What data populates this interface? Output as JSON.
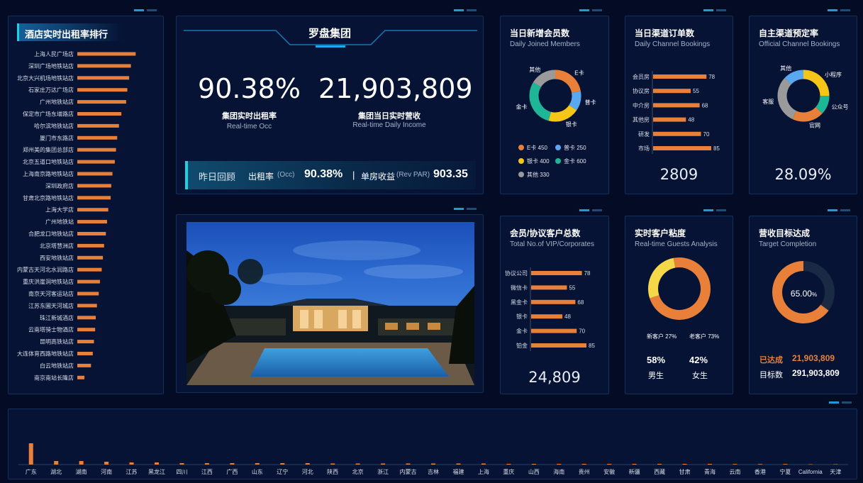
{
  "ranking": {
    "title": "酒店实时出租率排行",
    "items": [
      {
        "name": "上海人民广场店",
        "value": 0.98
      },
      {
        "name": "深圳广场地铁站店",
        "value": 0.9
      },
      {
        "name": "北京大兴机场地铁站店",
        "value": 0.87
      },
      {
        "name": "石家庄万达广场店",
        "value": 0.84
      },
      {
        "name": "广州地铁站店",
        "value": 0.82
      },
      {
        "name": "保定市广场东增路店",
        "value": 0.74
      },
      {
        "name": "哈尔滨地铁站店",
        "value": 0.7
      },
      {
        "name": "厦门市东路店",
        "value": 0.67
      },
      {
        "name": "郑州美的集团总部店",
        "value": 0.65
      },
      {
        "name": "北京五道口地铁站店",
        "value": 0.63
      },
      {
        "name": "上海南京路地铁站店",
        "value": 0.59
      },
      {
        "name": "深圳政府店",
        "value": 0.57
      },
      {
        "name": "甘肃北京路地铁站店",
        "value": 0.56
      },
      {
        "name": "上海大学店",
        "value": 0.52
      },
      {
        "name": "广州地铁站",
        "value": 0.5
      },
      {
        "name": "合肥龙口地铁站店",
        "value": 0.48
      },
      {
        "name": "北京塔慧洲店",
        "value": 0.45
      },
      {
        "name": "西安地铁站店",
        "value": 0.43
      },
      {
        "name": "内蒙古天河北水润路店",
        "value": 0.41
      },
      {
        "name": "重庆洪崖洞地铁站店",
        "value": 0.38
      },
      {
        "name": "南京天河客运站店",
        "value": 0.36
      },
      {
        "name": "江苏东圃天河城店",
        "value": 0.33
      },
      {
        "name": "珠江新城酒店",
        "value": 0.31
      },
      {
        "name": "云南塔骑士物酒店",
        "value": 0.3
      },
      {
        "name": "昆明高铁站店",
        "value": 0.28
      },
      {
        "name": "大连体育西路地铁站店",
        "value": 0.26
      },
      {
        "name": "白云地铁站店",
        "value": 0.23
      },
      {
        "name": "南京南站长隆店",
        "value": 0.12
      }
    ]
  },
  "group": {
    "name": "罗盘集团",
    "occ_value": "90.38%",
    "occ_label": "集团实时出租率",
    "occ_sub": "Real-time Occ",
    "income_value": "21,903,809",
    "income_label": "集团当日实时营收",
    "income_sub": "Real-time Daily Income",
    "review_label": "昨日回顾",
    "review_occ_label": "出租率",
    "review_occ_sub": "(Occ)",
    "review_occ_value": "90.38%",
    "review_sep": "|",
    "review_revpar_label": "单房收益",
    "review_revpar_sub": "(Rev PAR)",
    "review_revpar_value": "903.35"
  },
  "members": {
    "title": "当日新增会员数",
    "sub": "Daily Joined Members",
    "slices": [
      {
        "name": "E卡",
        "value": 450,
        "color": "#e8803a",
        "legend": "E卡 450"
      },
      {
        "name": "普卡",
        "value": 250,
        "color": "#5aa9f0",
        "legend": "普卡 250"
      },
      {
        "name": "银卡",
        "value": 400,
        "color": "#f5c518",
        "legend": "银卡 400"
      },
      {
        "name": "金卡",
        "value": 600,
        "color": "#1fb597",
        "legend": "金卡 600"
      },
      {
        "name": "其他",
        "value": 330,
        "color": "#9a9a9a",
        "legend": "其他 330"
      }
    ]
  },
  "channel": {
    "title": "当日渠道订单数",
    "sub": "Daily Channel Bookings",
    "total": "2809",
    "chart_data": {
      "type": "bar",
      "categories": [
        "会员房",
        "协议房",
        "中介房",
        "其他房",
        "研发",
        "市场"
      ],
      "values": [
        78,
        55,
        68,
        48,
        70,
        85
      ]
    }
  },
  "official": {
    "title": "自主渠道预定率",
    "sub": "Official Channel Bookings",
    "total": "28.09%",
    "slices": [
      {
        "name": "小程序",
        "value": 25,
        "color": "#f5c518"
      },
      {
        "name": "公众号",
        "value": 12,
        "color": "#1fb597"
      },
      {
        "name": "官网",
        "value": 20,
        "color": "#e8803a"
      },
      {
        "name": "客服",
        "value": 30,
        "color": "#9a9a9a"
      },
      {
        "name": "其他",
        "value": 13,
        "color": "#5aa9f0"
      }
    ]
  },
  "vip": {
    "title": "会员/协议客户总数",
    "sub": "Total No.of VIP/Corporates",
    "total": "24,809",
    "chart_data": {
      "type": "bar",
      "categories": [
        "协议公司",
        "微信卡",
        "黑金卡",
        "银卡",
        "金卡",
        "铂金"
      ],
      "values": [
        78,
        55,
        68,
        48,
        70,
        85
      ]
    }
  },
  "guests": {
    "title": "实时客户粘度",
    "sub": "Real-time Guests Analysis",
    "new_label": "新客户 27%",
    "old_label": "老客户 73%",
    "new_pct": 27,
    "male_pct": "58%",
    "female_pct": "42%",
    "male_label": "男生",
    "female_label": "女生"
  },
  "target": {
    "title": "营收目标达成",
    "sub": "Target Completion",
    "pct_value": "65.00",
    "pct_unit": "%",
    "pct": 65,
    "done_label": "已达成",
    "done_value": "21,903,809",
    "goal_label": "目标数",
    "goal_value": "291,903,809"
  },
  "provinces": {
    "chart_data": {
      "type": "bar",
      "categories": [
        "广东",
        "湖北",
        "湖南",
        "河南",
        "江苏",
        "黑龙江",
        "四川",
        "江西",
        "广西",
        "山东",
        "辽宁",
        "河北",
        "陕西",
        "北京",
        "浙江",
        "内蒙古",
        "吉林",
        "福建",
        "上海",
        "重庆",
        "山西",
        "海南",
        "贵州",
        "安徽",
        "新疆",
        "西藏",
        "甘肃",
        "青海",
        "云南",
        "香港",
        "宁夏",
        "California",
        "天津"
      ],
      "values": [
        30,
        5,
        5,
        4,
        3,
        3,
        2,
        2,
        2,
        2,
        2,
        2,
        1.5,
        1.5,
        1.5,
        1.5,
        1.5,
        1.5,
        1.5,
        1,
        1,
        1,
        1,
        1,
        1,
        1,
        1,
        1,
        0.8,
        0.8,
        0.8,
        0.5,
        0.5
      ]
    }
  },
  "colors": {
    "accent": "#e8803a",
    "panel": "#061334",
    "border": "#12305a"
  }
}
